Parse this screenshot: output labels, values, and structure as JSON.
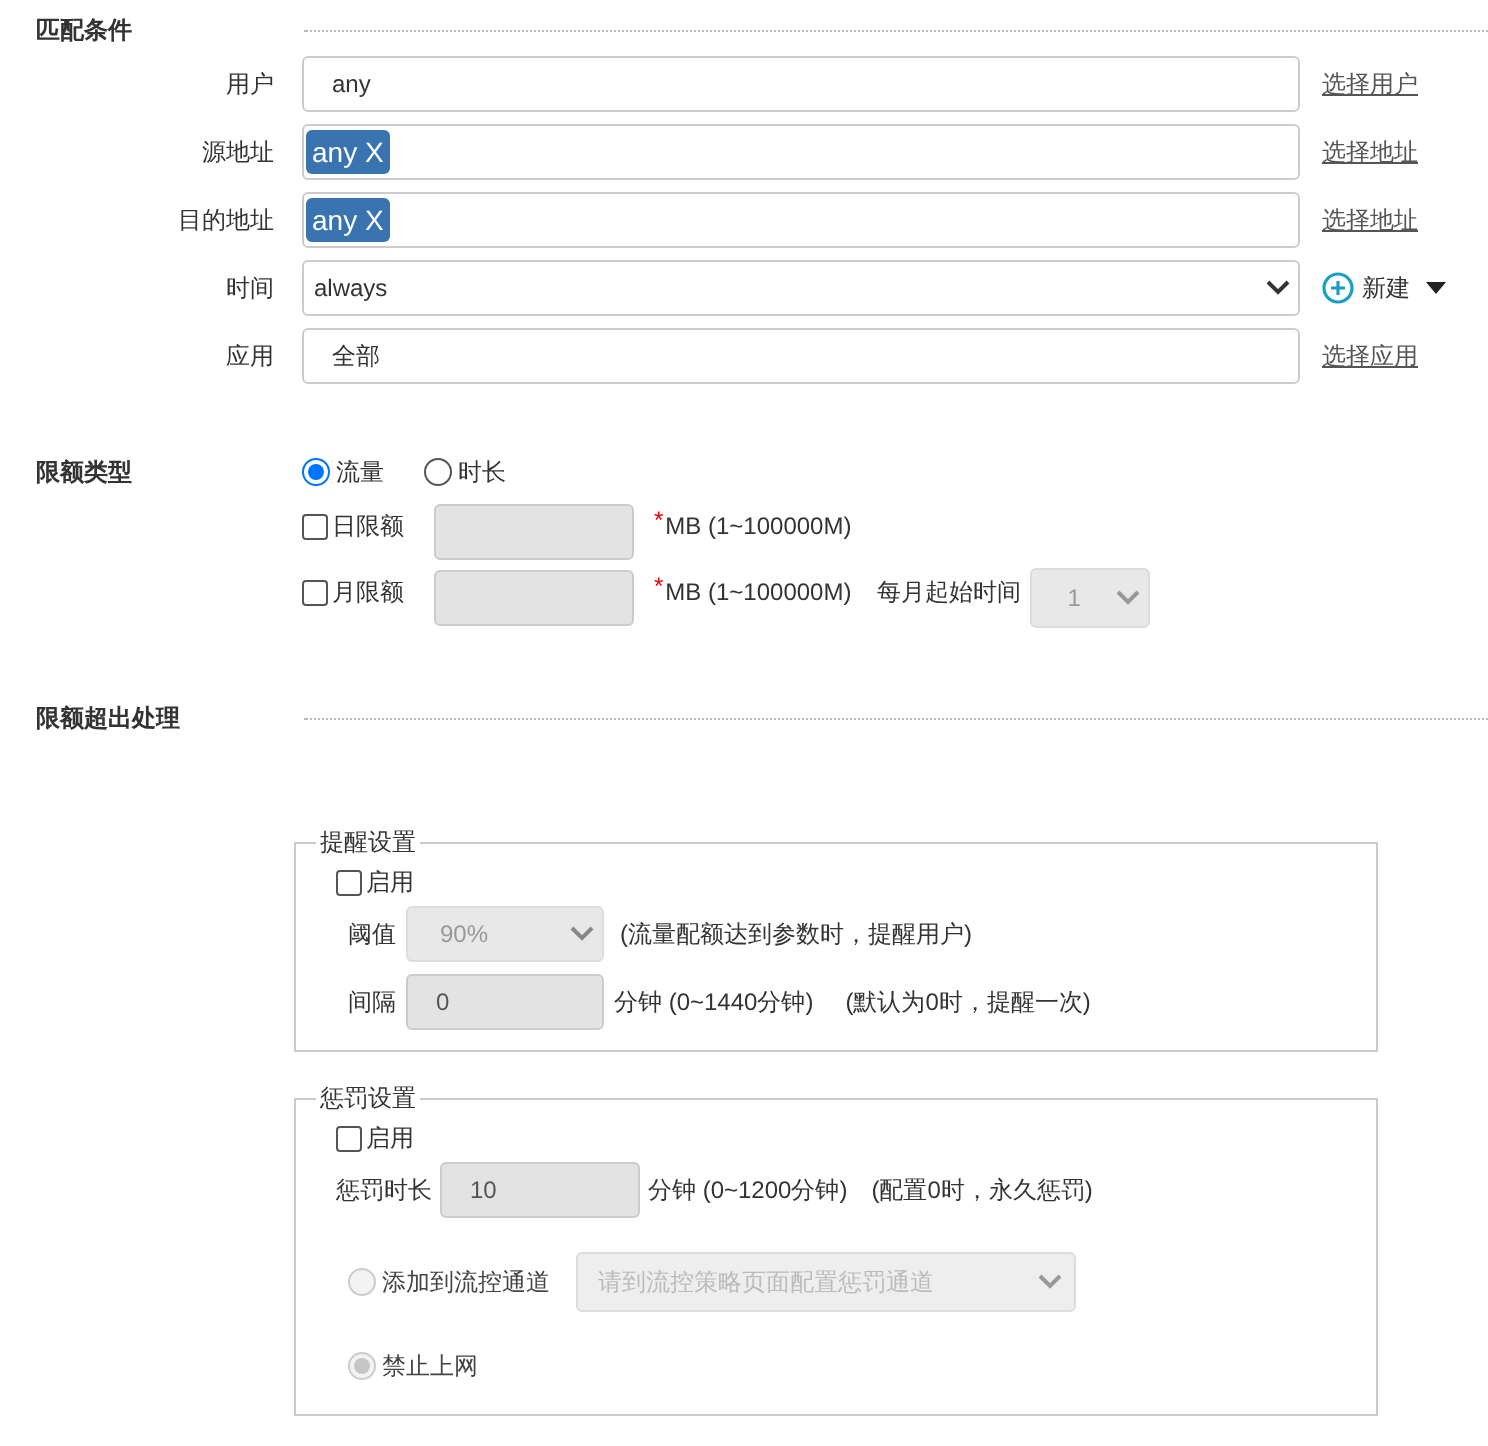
{
  "match": {
    "title": "匹配条件",
    "rows": [
      {
        "kind": "text",
        "label": "用户",
        "value": "any",
        "link": "选择用户"
      },
      {
        "kind": "tags",
        "label": "源地址",
        "tags": [
          "any X"
        ],
        "link": "选择地址"
      },
      {
        "kind": "tags",
        "label": "目的地址",
        "tags": [
          "any X"
        ],
        "link": "选择地址"
      },
      {
        "kind": "select",
        "label": "时间",
        "value": "always",
        "action": "新建"
      },
      {
        "kind": "text",
        "label": "应用",
        "value": "全部",
        "link": "选择应用"
      }
    ]
  },
  "quota_type": {
    "label": "限额类型",
    "options": [
      {
        "label": "流量",
        "selected": true
      },
      {
        "label": "时长",
        "selected": false
      }
    ],
    "limits": [
      {
        "label": "日限额",
        "checked": false,
        "disabled": true,
        "mark": "*",
        "unit": "MB (1~100000M)"
      },
      {
        "label": "月限额",
        "checked": false,
        "disabled": true,
        "mark": "*",
        "unit": "MB (1~100000M)",
        "start_label": "每月起始时间",
        "start_value": "1"
      }
    ]
  },
  "overflow": {
    "title": "限额超出处理",
    "reminder": {
      "legend": "提醒设置",
      "enable": {
        "label": "启用",
        "checked": false
      },
      "threshold": {
        "label": "阈值",
        "value": "90%",
        "disabled": true,
        "hint": "(流量配额达到参数时，提醒用户)"
      },
      "interval": {
        "label": "间隔",
        "value": "0",
        "disabled": true,
        "unit": "分钟 (0~1440分钟)",
        "hint": "(默认为0时，提醒一次)"
      }
    },
    "penalty": {
      "legend": "惩罚设置",
      "enable": {
        "label": "启用",
        "checked": false
      },
      "duration": {
        "label": "惩罚时长",
        "value": "10",
        "disabled": true,
        "unit": "分钟 (0~1200分钟)",
        "hint": "(配置0时，永久惩罚)"
      },
      "actions": [
        {
          "label": "添加到流控通道",
          "selected": false,
          "disabled": true,
          "select_placeholder": "请到流控策略页面配置惩罚通道"
        },
        {
          "label": "禁止上网",
          "selected": true,
          "disabled": true
        }
      ]
    }
  }
}
